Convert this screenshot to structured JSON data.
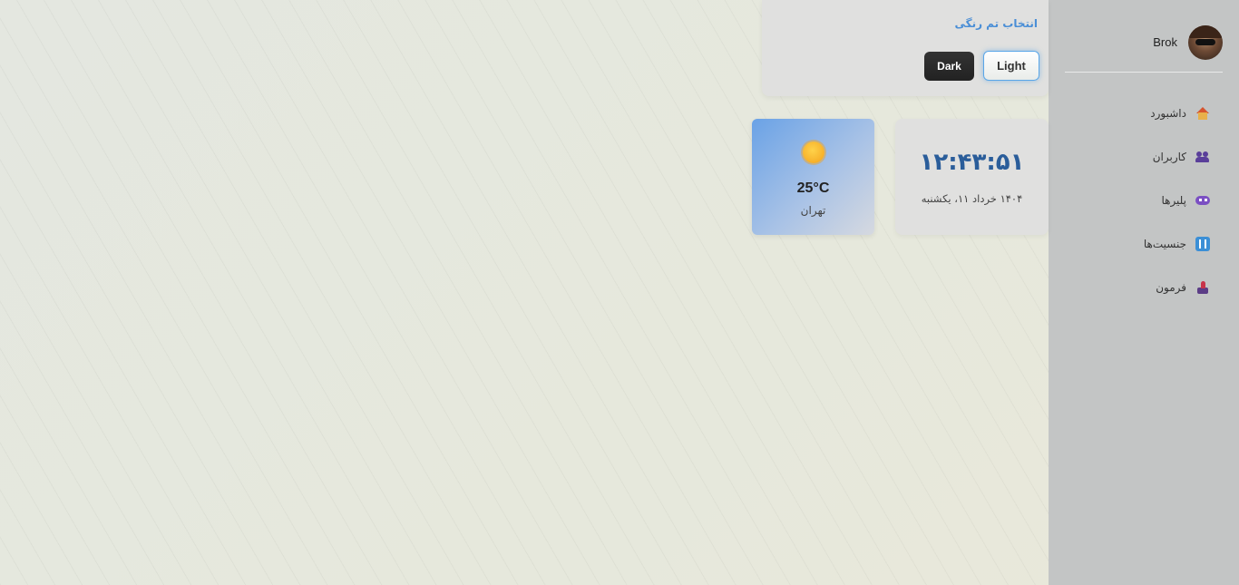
{
  "sidebar": {
    "username": "Brok",
    "items": [
      {
        "label": "داشبورد",
        "icon": "house-icon"
      },
      {
        "label": "کاربران",
        "icon": "users-icon"
      },
      {
        "label": "پلیرها",
        "icon": "gamepad-icon"
      },
      {
        "label": "جنسیت‌ها",
        "icon": "gender-icon"
      },
      {
        "label": "فرمون",
        "icon": "joystick-icon"
      }
    ]
  },
  "theme": {
    "title": "انتخاب تم رنگی",
    "light_label": "Light",
    "dark_label": "Dark",
    "selected": "Light"
  },
  "clock": {
    "time": "۱۲:۴۳:۵۱",
    "date": "۱۴۰۴ خرداد ۱۱، یکشنبه"
  },
  "weather": {
    "icon": "sun-icon",
    "temperature": "25°C",
    "city": "تهران"
  },
  "colors": {
    "accent": "#4a8ed6",
    "sidebar_bg": "#c3c5c5",
    "clock_text": "#2a5d9a"
  }
}
